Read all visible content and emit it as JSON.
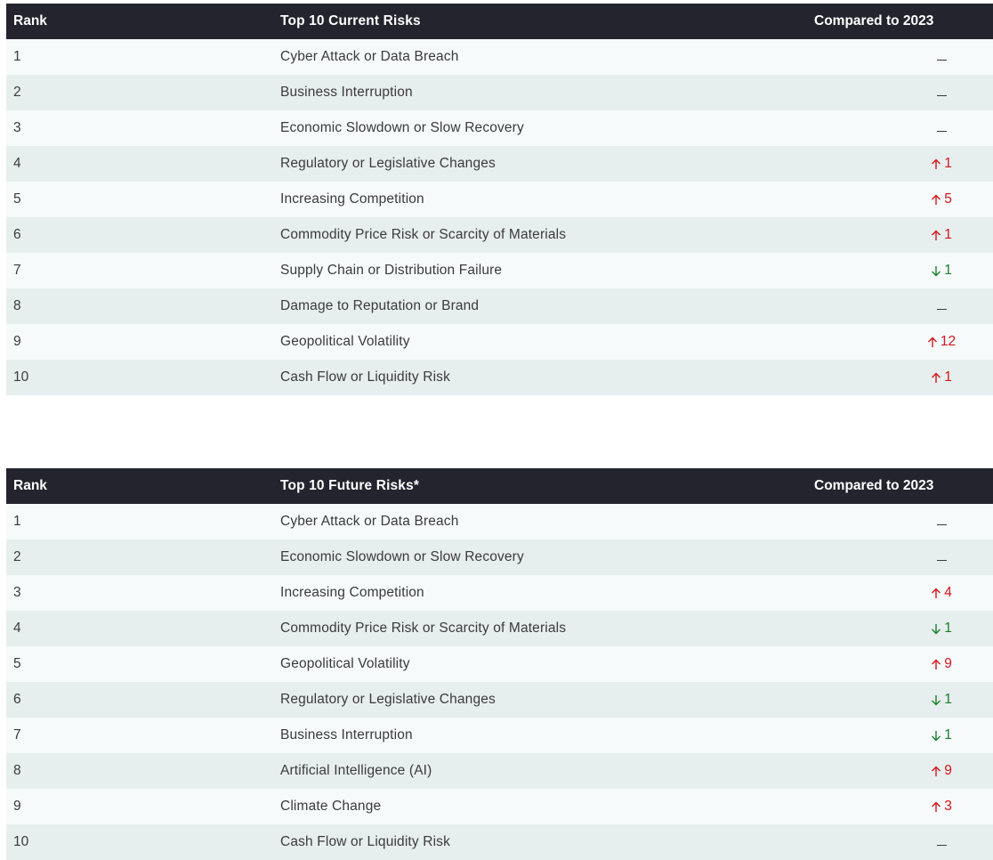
{
  "current": {
    "headers": {
      "rank": "Rank",
      "risk": "Top 10 Current Risks",
      "compare": "Compared to 2023"
    },
    "rows": [
      {
        "rank": "1",
        "risk": "Cyber Attack or Data Breach",
        "direction": "none",
        "change": ""
      },
      {
        "rank": "2",
        "risk": "Business Interruption",
        "direction": "none",
        "change": ""
      },
      {
        "rank": "3",
        "risk": "Economic Slowdown or Slow Recovery",
        "direction": "none",
        "change": ""
      },
      {
        "rank": "4",
        "risk": "Regulatory or Legislative Changes",
        "direction": "up",
        "change": "1"
      },
      {
        "rank": "5",
        "risk": "Increasing Competition",
        "direction": "up",
        "change": "5"
      },
      {
        "rank": "6",
        "risk": "Commodity Price Risk or Scarcity of Materials",
        "direction": "up",
        "change": "1"
      },
      {
        "rank": "7",
        "risk": "Supply Chain or Distribution Failure",
        "direction": "down",
        "change": "1"
      },
      {
        "rank": "8",
        "risk": "Damage to Reputation or Brand",
        "direction": "none",
        "change": ""
      },
      {
        "rank": "9",
        "risk": "Geopolitical Volatility",
        "direction": "up",
        "change": "12"
      },
      {
        "rank": "10",
        "risk": "Cash Flow or Liquidity Risk",
        "direction": "up",
        "change": "1"
      }
    ]
  },
  "future": {
    "headers": {
      "rank": "Rank",
      "risk": "Top 10 Future Risks*",
      "compare": "Compared to 2023"
    },
    "rows": [
      {
        "rank": "1",
        "risk": "Cyber Attack or Data Breach",
        "direction": "none",
        "change": ""
      },
      {
        "rank": "2",
        "risk": "Economic Slowdown or Slow Recovery",
        "direction": "none",
        "change": ""
      },
      {
        "rank": "3",
        "risk": "Increasing Competition",
        "direction": "up",
        "change": "4"
      },
      {
        "rank": "4",
        "risk": "Commodity Price Risk or Scarcity of Materials",
        "direction": "down",
        "change": "1"
      },
      {
        "rank": "5",
        "risk": "Geopolitical Volatility",
        "direction": "up",
        "change": "9"
      },
      {
        "rank": "6",
        "risk": "Regulatory or Legislative Changes",
        "direction": "down",
        "change": "1"
      },
      {
        "rank": "7",
        "risk": "Business Interruption",
        "direction": "down",
        "change": "1"
      },
      {
        "rank": "8",
        "risk": "Artificial Intelligence (AI)",
        "direction": "up",
        "change": "9"
      },
      {
        "rank": "9",
        "risk": "Climate Change",
        "direction": "up",
        "change": "3"
      },
      {
        "rank": "10",
        "risk": "Cash Flow or Liquidity Risk",
        "direction": "none",
        "change": ""
      }
    ]
  },
  "colors": {
    "header_bg": "#24242e",
    "up": "#d6161c",
    "down": "#1a7f2e",
    "row_light": "#f6fafa",
    "row_dark": "#e7eeee"
  },
  "icons": {
    "up": "arrow-up-icon",
    "down": "arrow-down-icon",
    "none": "dash-icon"
  }
}
